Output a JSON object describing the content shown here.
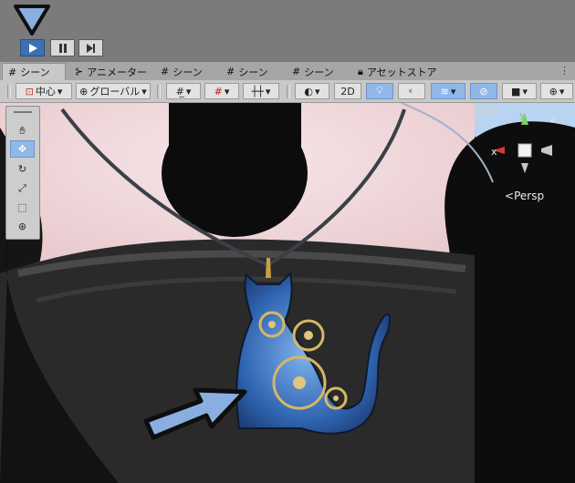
{
  "playbar": {
    "play": "play-icon",
    "pause": "pause-icon",
    "step": "step-icon"
  },
  "tabs": [
    {
      "label": "シーン",
      "icon": "grid-icon"
    },
    {
      "label": "アニメーター",
      "icon": "animator-icon"
    },
    {
      "label": "シーン",
      "icon": "grid-icon"
    },
    {
      "label": "シーン",
      "icon": "grid-icon"
    },
    {
      "label": "シーン",
      "icon": "grid-icon"
    },
    {
      "label": "アセットストア",
      "icon": "bag-icon"
    }
  ],
  "toolbar": {
    "pivot_label": "中心",
    "space_label": "グローバル",
    "mode_2d": "2D"
  },
  "gizmo": {
    "x": "x",
    "y": "y",
    "persp": "Persp"
  },
  "colors": {
    "accent": "#3d6fb3",
    "callout": "#8aaee0"
  }
}
